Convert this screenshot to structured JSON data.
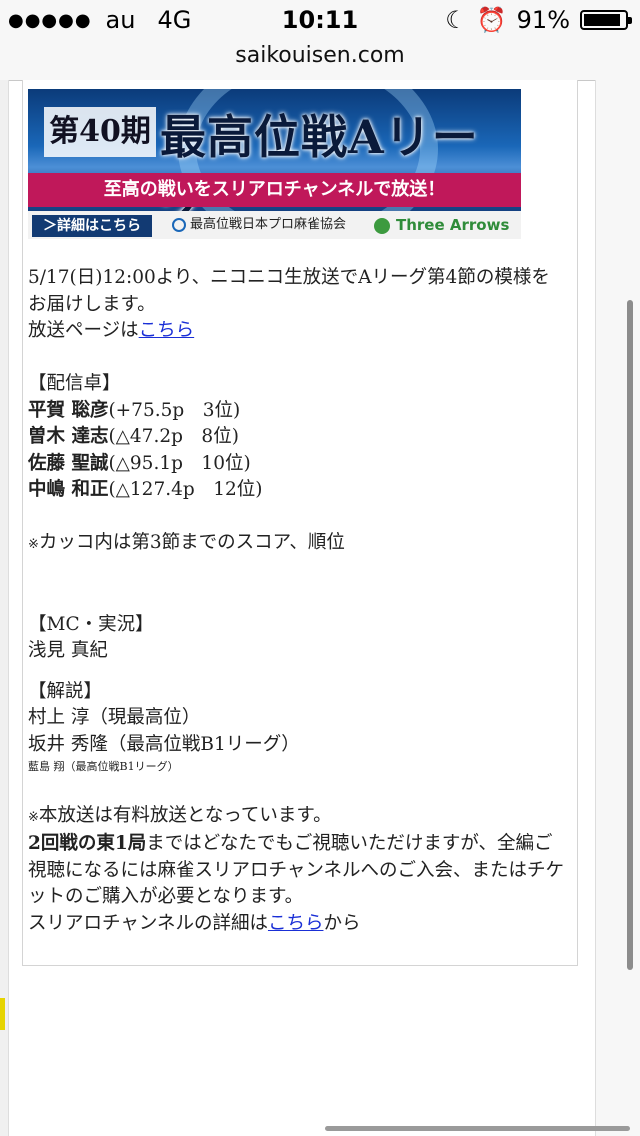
{
  "status_bar": {
    "signal": "●●●●●",
    "carrier": "au",
    "network": "4G",
    "time": "10:11",
    "battery_pct_label": "91%",
    "battery_level": 0.91
  },
  "browser": {
    "url": "saikouisen.com"
  },
  "banner": {
    "season": "第40期",
    "title": "最高位戦Aリーグ",
    "tagline": "至高の戦いをスリアロチャンネルで放送！",
    "detail_button": "＞詳細はこちら",
    "association": "最高位戦日本プロ麻雀協会",
    "sponsor": "Three Arrows"
  },
  "intro": {
    "line1": "5/17(日)12:00より、ニコニコ生放送でAリーグ第4節の模様をお届けします。",
    "broadcast_prefix": "放送ページは",
    "broadcast_link": "こちら"
  },
  "players": {
    "heading": "【配信卓】",
    "list": [
      {
        "name": "平賀 聡彦",
        "score": "(+75.5p　3位)"
      },
      {
        "name": "曽木 達志",
        "score": "(△47.2p　8位)"
      },
      {
        "name": "佐藤 聖誠",
        "score": "(△95.1p　10位)"
      },
      {
        "name": "中嶋 和正",
        "score": "(△127.4p　12位)"
      }
    ],
    "note_mark": "※",
    "note": "カッコ内は第3節までのスコア、順位"
  },
  "mc": {
    "heading": "【MC・実況】",
    "name": "浅見 真紀"
  },
  "commentary": {
    "heading": "【解説】",
    "line1": "村上 淳（現最高位）",
    "line2": "坂井 秀隆（最高位戦B1リーグ）",
    "line3": "藍島 翔（最高位戦B1リーグ）"
  },
  "paid": {
    "mark": "※",
    "line1": "本放送は有料放送となっています。",
    "bold": "2回戦の東1局",
    "rest": "まではどなたでもご視聴いただけますが、全編ご視聴になるには麻雀スリアロチャンネルへのご入会、またはチケットのご購入が必要となります。",
    "channel_prefix": "スリアロチャンネルの詳細は",
    "channel_link": "こちら",
    "channel_suffix": "から"
  }
}
